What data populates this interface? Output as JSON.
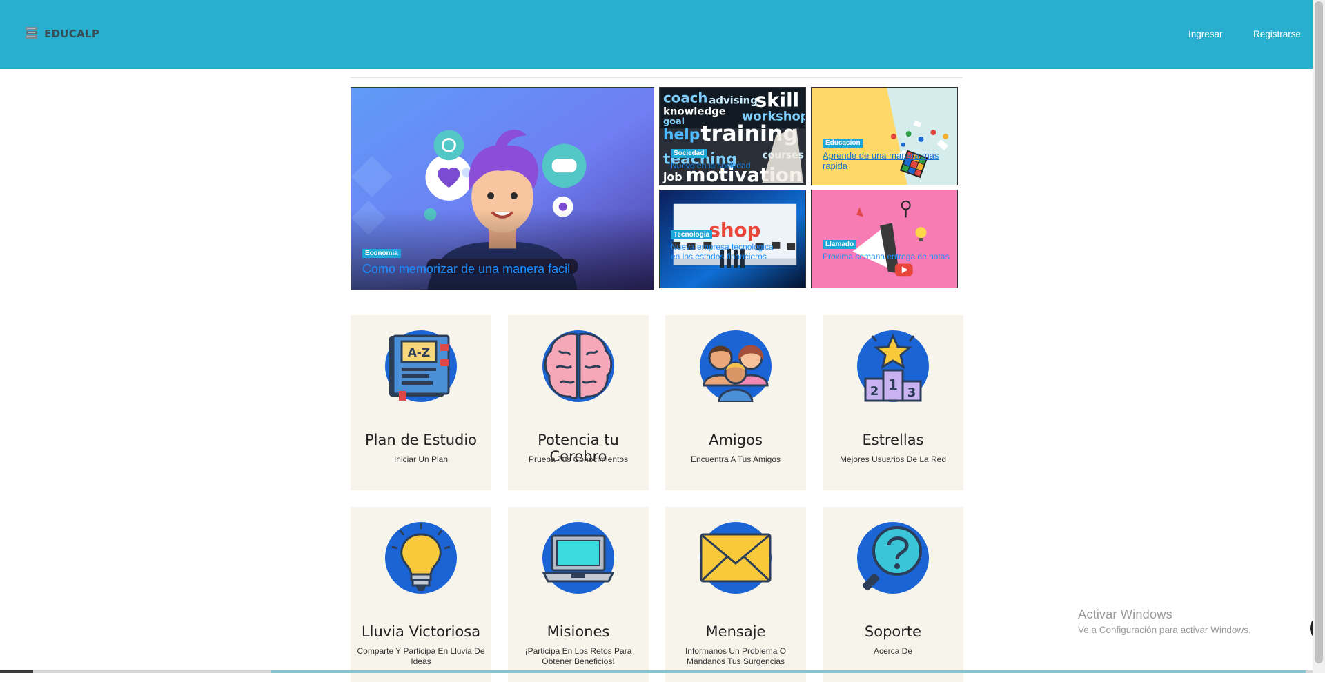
{
  "header": {
    "brand": "EDUCALP",
    "login": "Ingresar",
    "register": "Registrarse",
    "color": "#28afcf"
  },
  "featured": {
    "main": {
      "tag": "Economia",
      "title": "Como memorizar de una manera facil"
    },
    "items": [
      {
        "tag": "Sociedad",
        "title": "Nuevo en la sociedad"
      },
      {
        "tag": "Educacion",
        "title": "Aprende de una manera mas rapida"
      },
      {
        "tag": "Tecnologia",
        "title": "Nueva empresa tecnologica en los estados financieros"
      },
      {
        "tag": "Llamado",
        "title": "Proxima semana entrega de notas"
      }
    ]
  },
  "cards": [
    {
      "title": "Plan de Estudio",
      "subtitle": "Iniciar Un Plan",
      "icon": "dictionary-book-icon"
    },
    {
      "title": "Potencia tu Cerebro",
      "subtitle": "Prueba Tus Conocimientos",
      "icon": "brain-icon"
    },
    {
      "title": "Amigos",
      "subtitle": "Encuentra A Tus Amigos",
      "icon": "friends-icon"
    },
    {
      "title": "Estrellas",
      "subtitle": "Mejores Usuarios De La Red",
      "icon": "podium-star-icon"
    },
    {
      "title": "Lluvia Victoriosa",
      "subtitle": "Comparte Y Participa En Lluvia De Ideas",
      "icon": "lightbulb-icon"
    },
    {
      "title": "Misiones",
      "subtitle": "¡Participa En Los Retos Para Obtener Beneficios!",
      "icon": "laptop-icon"
    },
    {
      "title": "Mensaje",
      "subtitle": "Informanos Un Problema O Mandanos Tus Surgencias",
      "icon": "envelope-icon"
    },
    {
      "title": "Soporte",
      "subtitle": "Acerca De",
      "icon": "help-magnifier-icon"
    }
  ],
  "watermark": {
    "line1": "Activar Windows",
    "line2": "Ve a Configuración para activar Windows."
  },
  "tile_words": {
    "sociedad": [
      "coach",
      "advising",
      "skill",
      "knowledge",
      "workshop",
      "goal",
      "help",
      "training",
      "teaching",
      "courses",
      "job",
      "motivation"
    ],
    "tecnologia": "shop"
  }
}
